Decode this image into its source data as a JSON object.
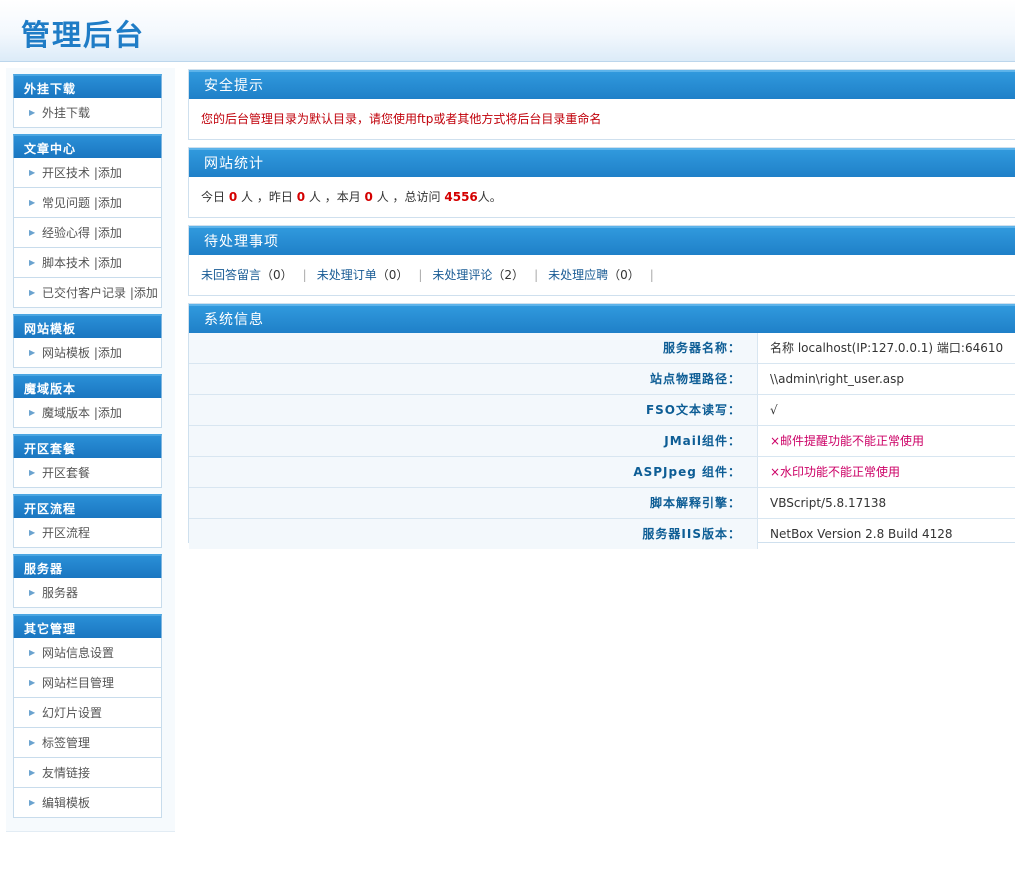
{
  "header": {
    "title": "管理后台"
  },
  "sidebar": {
    "groups": [
      {
        "title": "外挂下载",
        "items": [
          {
            "label": "外挂下载",
            "add": ""
          }
        ]
      },
      {
        "title": "文章中心",
        "items": [
          {
            "label": "开区技术",
            "add": " |添加"
          },
          {
            "label": "常见问题",
            "add": " |添加"
          },
          {
            "label": "经验心得",
            "add": " |添加"
          },
          {
            "label": "脚本技术",
            "add": " |添加"
          },
          {
            "label": "已交付客户记录",
            "add": " |添加"
          }
        ]
      },
      {
        "title": "网站模板",
        "items": [
          {
            "label": "网站模板",
            "add": " |添加"
          }
        ]
      },
      {
        "title": "魔域版本",
        "items": [
          {
            "label": "魔域版本",
            "add": " |添加"
          }
        ]
      },
      {
        "title": "开区套餐",
        "items": [
          {
            "label": "开区套餐",
            "add": ""
          }
        ]
      },
      {
        "title": "开区流程",
        "items": [
          {
            "label": "开区流程",
            "add": ""
          }
        ]
      },
      {
        "title": "服务器",
        "items": [
          {
            "label": "服务器",
            "add": ""
          }
        ]
      },
      {
        "title": "其它管理",
        "items": [
          {
            "label": "网站信息设置",
            "add": ""
          },
          {
            "label": "网站栏目管理",
            "add": ""
          },
          {
            "label": "幻灯片设置",
            "add": ""
          },
          {
            "label": "标签管理",
            "add": ""
          },
          {
            "label": "友情链接",
            "add": ""
          },
          {
            "label": "编辑模板",
            "add": ""
          }
        ]
      }
    ]
  },
  "security": {
    "title": "安全提示",
    "message": "您的后台管理目录为默认目录，请您使用ftp或者其他方式将后台目录重命名"
  },
  "stats": {
    "title": "网站统计",
    "today_label": "今日",
    "today": "0",
    "yesterday_label": "人 ，昨日",
    "yesterday": "0",
    "month_label": "人 ，本月",
    "month": "0",
    "total_label": "人 ，总访问",
    "total": "4556",
    "suffix": "人。"
  },
  "todo": {
    "title": "待处理事项",
    "items": [
      {
        "label": "未回答留言",
        "count": "（0）"
      },
      {
        "label": "未处理订单",
        "count": "（0）"
      },
      {
        "label": "未处理评论",
        "count": "（2）"
      },
      {
        "label": "未处理应聘",
        "count": "（0）"
      }
    ],
    "separator": "|"
  },
  "sysinfo": {
    "title": "系统信息",
    "rows": [
      {
        "label": "服务器名称：",
        "value": "名称  localhost(IP:127.0.0.1) 端口:64610"
      },
      {
        "label": "站点物理路径：",
        "value": "\\\\admin\\right_user.asp"
      },
      {
        "label": "FSO文本读写：",
        "value": "√"
      },
      {
        "label": "JMail组件：",
        "value": "×邮件提醒功能不能正常使用"
      },
      {
        "label": "ASPJpeg 组件：",
        "value": "×水印功能不能正常使用"
      },
      {
        "label": "脚本解释引擎：",
        "value": "VBScript/5.8.17138"
      },
      {
        "label": "服务器IIS版本：",
        "value": "NetBox Version 2.8 Build 4128"
      }
    ]
  }
}
